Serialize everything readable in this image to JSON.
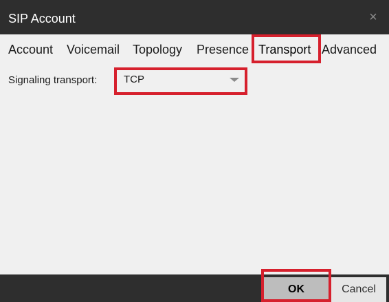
{
  "window": {
    "title": "SIP Account",
    "close_glyph": "×"
  },
  "tabs": [
    {
      "label": "Account"
    },
    {
      "label": "Voicemail"
    },
    {
      "label": "Topology"
    },
    {
      "label": "Presence"
    },
    {
      "label": "Transport",
      "active": true
    },
    {
      "label": "Advanced"
    }
  ],
  "transport": {
    "signaling_label": "Signaling transport:",
    "signaling_value": "TCP"
  },
  "footer": {
    "ok_label": "OK",
    "cancel_label": "Cancel"
  },
  "icons": {
    "close": "close-icon",
    "dropdown": "chevron-down-icon"
  },
  "colors": {
    "titlebar": "#2e2e2e",
    "highlight": "#d6202d",
    "ok_button": "#bdbdbd"
  }
}
